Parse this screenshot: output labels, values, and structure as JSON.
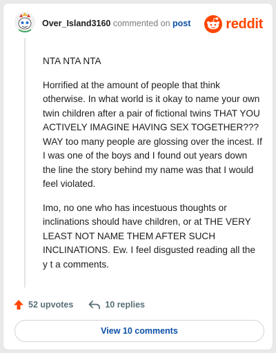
{
  "header": {
    "username": "Over_Island3160",
    "action_text": "commented on",
    "post_link": "post",
    "brand": "reddit"
  },
  "comment": {
    "paragraphs": [
      "NTA NTA NTA",
      "Horrified at the amount of people that think otherwise. In what world is it okay to name your own twin children after a pair of fictional twins THAT YOU ACTIVELY IMAGINE HAVING SEX TOGETHER??? WAY too many people are glossing over the incest. If I was one of the boys and I found out years down the line the story behind my name was that I would feel violated.",
      "Imo, no one who has incestuous thoughts or inclinations should have children, or at THE VERY LEAST NOT NAME THEM AFTER SUCH INCLINATIONS. Ew. I feel disgusted reading all the y t a comments."
    ]
  },
  "actions": {
    "upvotes": "52 upvotes",
    "replies": "10 replies"
  },
  "footer": {
    "view_comments": "View 10 comments"
  },
  "colors": {
    "brand": "#ff4500",
    "link": "#0a4fa6",
    "upvote": "#ff4500"
  },
  "icons": [
    "user-avatar",
    "reddit-logo-icon",
    "upvote-arrow-icon",
    "reply-arrow-icon"
  ]
}
